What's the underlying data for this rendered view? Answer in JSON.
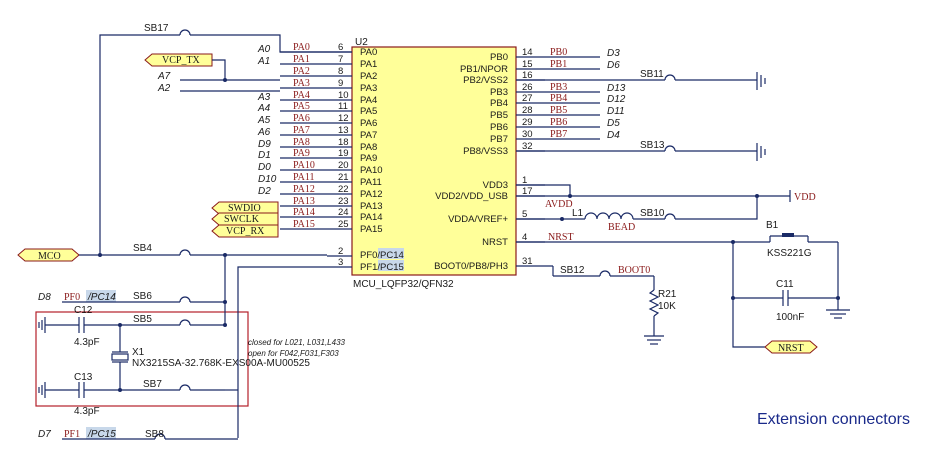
{
  "chip": {
    "ref": "U2",
    "part": "MCU_LQFP32/QFN32",
    "left_pins": [
      {
        "num": "6",
        "name": "PA0"
      },
      {
        "num": "7",
        "name": "PA1"
      },
      {
        "num": "8",
        "name": "PA2"
      },
      {
        "num": "9",
        "name": "PA3"
      },
      {
        "num": "10",
        "name": "PA4"
      },
      {
        "num": "11",
        "name": "PA5"
      },
      {
        "num": "12",
        "name": "PA6"
      },
      {
        "num": "13",
        "name": "PA7"
      },
      {
        "num": "18",
        "name": "PA8"
      },
      {
        "num": "19",
        "name": "PA9"
      },
      {
        "num": "20",
        "name": "PA10"
      },
      {
        "num": "21",
        "name": "PA11"
      },
      {
        "num": "22",
        "name": "PA12"
      },
      {
        "num": "23",
        "name": "PA13"
      },
      {
        "num": "24",
        "name": "PA14"
      },
      {
        "num": "25",
        "name": "PA15"
      }
    ],
    "right_pins": [
      {
        "num": "14",
        "name": "PB0"
      },
      {
        "num": "15",
        "name": "PB1/NPOR"
      },
      {
        "num": "16",
        "name": "PB2/VSS2"
      },
      {
        "num": "26",
        "name": "PB3"
      },
      {
        "num": "27",
        "name": "PB4"
      },
      {
        "num": "28",
        "name": "PB5"
      },
      {
        "num": "29",
        "name": "PB6"
      },
      {
        "num": "30",
        "name": "PB7"
      },
      {
        "num": "32",
        "name": "PB8/VSS3"
      },
      {
        "num": "1",
        "name": "VDD3"
      },
      {
        "num": "17",
        "name": "VDD2/VDD_USB"
      },
      {
        "num": "5",
        "name": "VDDA/VREF+"
      },
      {
        "num": "4",
        "name": "NRST"
      },
      {
        "num": "31",
        "name": "BOOT0/PB8/PH3"
      }
    ],
    "pf_pins": [
      {
        "num": "2",
        "name": "PF0/PC14"
      },
      {
        "num": "3",
        "name": "PF1/PC15"
      }
    ]
  },
  "left_nets": [
    {
      "arduino": "A0",
      "net": "PA0"
    },
    {
      "arduino": "A1",
      "net": "PA1"
    },
    {
      "arduino": "A7",
      "net": "PA2"
    },
    {
      "arduino": "A2",
      "net": "PA3"
    },
    {
      "arduino": "A3",
      "net": "PA4"
    },
    {
      "arduino": "A4",
      "net": "PA5"
    },
    {
      "arduino": "A5",
      "net": "PA6"
    },
    {
      "arduino": "A6",
      "net": "PA7"
    },
    {
      "arduino": "D9",
      "net": "PA8"
    },
    {
      "arduino": "D1",
      "net": "PA9"
    },
    {
      "arduino": "D0",
      "net": "PA10"
    },
    {
      "arduino": "D10",
      "net": "PA11"
    },
    {
      "arduino": "D2",
      "net": "PA12"
    },
    {
      "arduino": "",
      "net": "PA13"
    },
    {
      "arduino": "",
      "net": "PA14"
    },
    {
      "arduino": "",
      "net": "PA15"
    }
  ],
  "right_nets": [
    {
      "net": "PB0",
      "arduino": "D3"
    },
    {
      "net": "PB1",
      "arduino": "D6"
    },
    {
      "net": "PB3",
      "arduino": "D13"
    },
    {
      "net": "PB4",
      "arduino": "D12"
    },
    {
      "net": "PB5",
      "arduino": "D11"
    },
    {
      "net": "PB6",
      "arduino": "D5"
    },
    {
      "net": "PB7",
      "arduino": "D4"
    }
  ],
  "ports": {
    "vcp_tx": "VCP_TX",
    "swdio": "SWDIO",
    "swclk": "SWCLK",
    "vcp_rx": "VCP_RX",
    "mco": "MCO",
    "vdd": "VDD",
    "nrst": "NRST"
  },
  "solder_bridges": {
    "sb17": "SB17",
    "sb11": "SB11",
    "sb13": "SB13",
    "sb10": "SB10",
    "sb4": "SB4",
    "sb6": "SB6",
    "sb5": "SB5",
    "sb7": "SB7",
    "sb8": "SB8",
    "sb12": "SB12"
  },
  "components": {
    "l1_ref": "L1",
    "l1_val": "BEAD",
    "avdd": "AVDD",
    "nrst_net": "NRST",
    "boot0_net": "BOOT0",
    "b1_ref": "B1",
    "b1_val": "KSS221G",
    "c11_ref": "C11",
    "c11_val": "100nF",
    "r21_ref": "R21",
    "r21_val": "10K",
    "c12_ref": "C12",
    "c12_val": "4.3pF",
    "c13_ref": "C13",
    "c13_val": "4.3pF",
    "x1_ref": "X1",
    "x1_val": "NX3215SA-32.768K-EXS00A-MU00525"
  },
  "osc": {
    "d8": "D8",
    "pf0": "PF0",
    "pc14": "/PC14",
    "d7": "D7",
    "pf1": "PF1",
    "pc15": "/PC15",
    "note1": "closed for L021, L031,L433",
    "note2": "open for F042,F031,F303"
  },
  "title": "Extension connectors"
}
